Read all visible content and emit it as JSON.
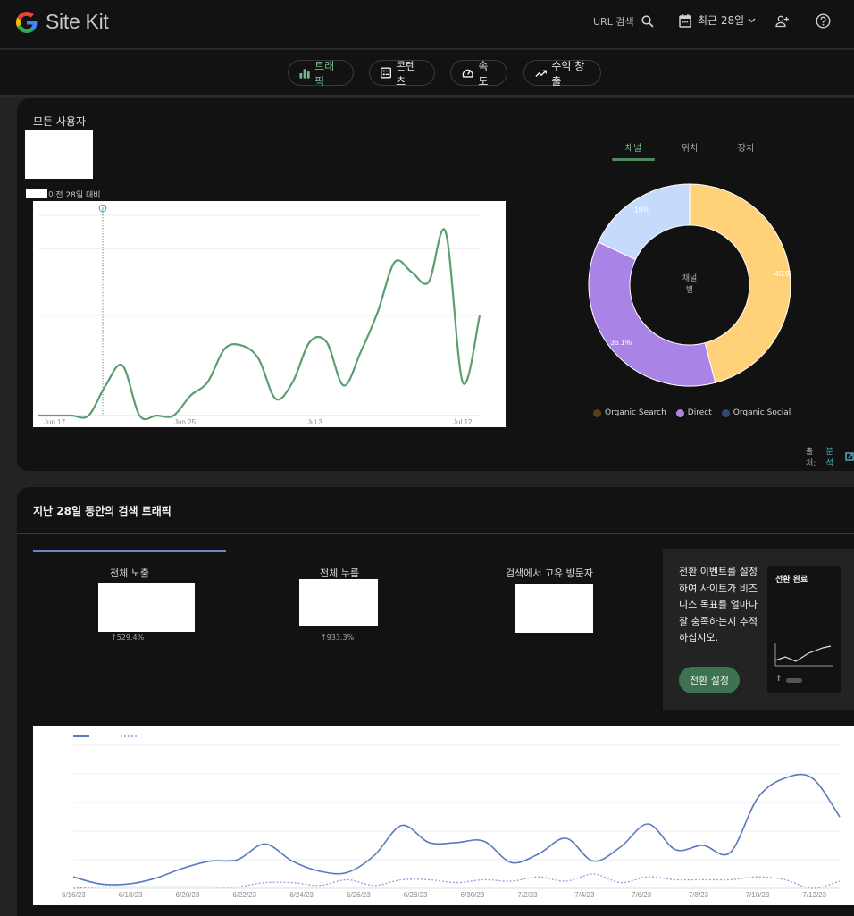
{
  "header": {
    "app_title": "Site Kit",
    "url_search_label": "URL 검색",
    "date_range_label": "최근 28일",
    "icons": [
      "google-logo",
      "search-icon",
      "calendar-icon",
      "chevron-down-icon",
      "add-user-icon",
      "help-icon"
    ]
  },
  "nav": {
    "chips": [
      {
        "label": "트래픽",
        "icon": "bar-chart-icon",
        "active": true
      },
      {
        "label": "콘텐츠",
        "icon": "content-list-icon",
        "active": false
      },
      {
        "label": "속도",
        "icon": "speedometer-icon",
        "active": false
      },
      {
        "label": "수익 창출",
        "icon": "trending-up-icon",
        "active": false
      }
    ]
  },
  "audience_card": {
    "title": "모든 사용자",
    "compare_label": "이전 28일 대비",
    "tabs": [
      {
        "label": "채널",
        "active": true
      },
      {
        "label": "위치",
        "active": false
      },
      {
        "label": "장치",
        "active": false
      }
    ],
    "donut_center_line1": "채널",
    "donut_center_line2": "별",
    "source_label": "출처:",
    "source_link": "분석"
  },
  "search_card": {
    "title": "지난 28일 동안의 검색 트래픽",
    "metrics": [
      {
        "label": "전체 노출",
        "change": "529.4%"
      },
      {
        "label": "전체 누름",
        "change": "933.3%"
      },
      {
        "label": "검색에서 고유 방문자",
        "change": ""
      }
    ],
    "cta": {
      "text": "전환 이벤트를 설정하여 사이트가 비즈니스 목표를 얼마나 잘 충족하는지 추적하십시오.",
      "button_label": "전환 설정",
      "preview_title": "전환 완료"
    }
  },
  "chart_data": [
    {
      "type": "line",
      "title": "모든 사용자",
      "x_ticks": [
        "Jun 17",
        "Jun 25",
        "Jul 3",
        "Jul 12"
      ],
      "xlabel": "",
      "ylabel": "",
      "grid": true,
      "annotation": "info marker near Jun 19",
      "series": [
        {
          "name": "users",
          "color": "#5c9e72",
          "values": [
            0,
            0,
            0,
            0,
            0.9,
            1.5,
            0,
            0,
            0,
            0.6,
            1.0,
            2.0,
            2.1,
            1.7,
            0.5,
            1.0,
            2.2,
            2.2,
            0.9,
            1.9,
            3.1,
            4.6,
            4.3,
            4.0,
            5.5,
            1.0,
            3.0
          ]
        }
      ],
      "ylim": [
        0,
        6
      ]
    },
    {
      "type": "pie",
      "title": "채널 별",
      "labels": [
        "Organic Search",
        "Direct",
        "Organic Social"
      ],
      "values": [
        45.9,
        36.1,
        18.0
      ],
      "colors": [
        "#ffd27a",
        "#a983e6",
        "#c6dafc"
      ],
      "legend_colors": [
        "#5a3f0f",
        "#a983e6",
        "#2f4a7a"
      ],
      "data_labels": [
        "45.9%",
        "36.1%",
        "18%"
      ],
      "legend": "bottom"
    },
    {
      "type": "line",
      "title": "지난 28일 동안의 검색 트래픽",
      "x_ticks": [
        "6/16/23",
        "6/18/23",
        "6/20/23",
        "6/22/23",
        "6/24/23",
        "6/26/23",
        "6/28/23",
        "6/30/23",
        "7/2/23",
        "7/4/23",
        "7/6/23",
        "7/8/23",
        "7/10/23",
        "7/12/23"
      ],
      "grid": true,
      "series": [
        {
          "name": "current",
          "style": "solid",
          "color": "#5a7ac0",
          "values": [
            0.4,
            0.15,
            0.15,
            0.35,
            0.7,
            0.95,
            1.0,
            1.55,
            0.95,
            0.6,
            0.55,
            1.15,
            2.2,
            1.6,
            1.6,
            1.65,
            0.9,
            1.2,
            1.75,
            0.95,
            1.45,
            2.25,
            1.35,
            1.5,
            1.25,
            3.15,
            3.85,
            3.85,
            2.5
          ],
          "approx_of": "28 days"
        },
        {
          "name": "previous",
          "style": "dashed",
          "color": "#8ea3d8",
          "values": [
            0.0,
            0.05,
            0.05,
            0.05,
            0.05,
            0.05,
            0.05,
            0.2,
            0.2,
            0.1,
            0.3,
            0.1,
            0.3,
            0.3,
            0.2,
            0.3,
            0.25,
            0.4,
            0.25,
            0.5,
            0.2,
            0.4,
            0.3,
            0.3,
            0.3,
            0.4,
            0.3,
            0.0,
            0.25
          ]
        }
      ],
      "ylim": [
        0,
        5
      ]
    }
  ]
}
